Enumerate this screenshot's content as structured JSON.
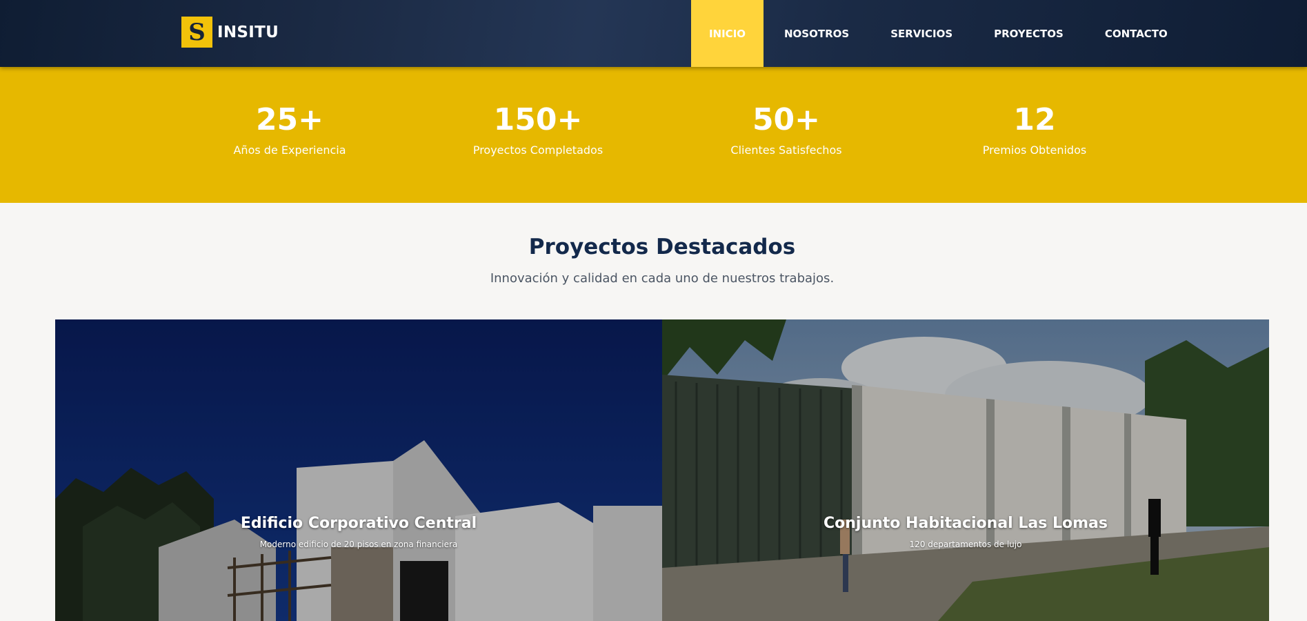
{
  "brand": {
    "logo_letter": "S",
    "name": "INSITU"
  },
  "nav": {
    "items": [
      {
        "label": "INICIO",
        "active": true
      },
      {
        "label": "NOSOTROS",
        "active": false
      },
      {
        "label": "SERVICIOS",
        "active": false
      },
      {
        "label": "PROYECTOS",
        "active": false
      },
      {
        "label": "CONTACTO",
        "active": false
      }
    ]
  },
  "stats": [
    {
      "value": "25+",
      "label": "Años de Experiencia"
    },
    {
      "value": "150+",
      "label": "Proyectos Completados"
    },
    {
      "value": "50+",
      "label": "Clientes Satisfechos"
    },
    {
      "value": "12",
      "label": "Premios Obtenidos"
    }
  ],
  "projects": {
    "title": "Proyectos Destacados",
    "subtitle": "Innovación y calidad en cada uno de nuestros trabajos.",
    "cards": [
      {
        "title": "Edificio Corporativo Central",
        "description": "Moderno edificio de 20 pisos en zona financiera"
      },
      {
        "title": "Conjunto Habitacional Las Lomas",
        "description": "120 departamentos de lujo"
      }
    ]
  },
  "colors": {
    "header": "#152338",
    "accent": "#ffd43b",
    "stats_band": "#e6b800",
    "heading": "#13294b"
  }
}
